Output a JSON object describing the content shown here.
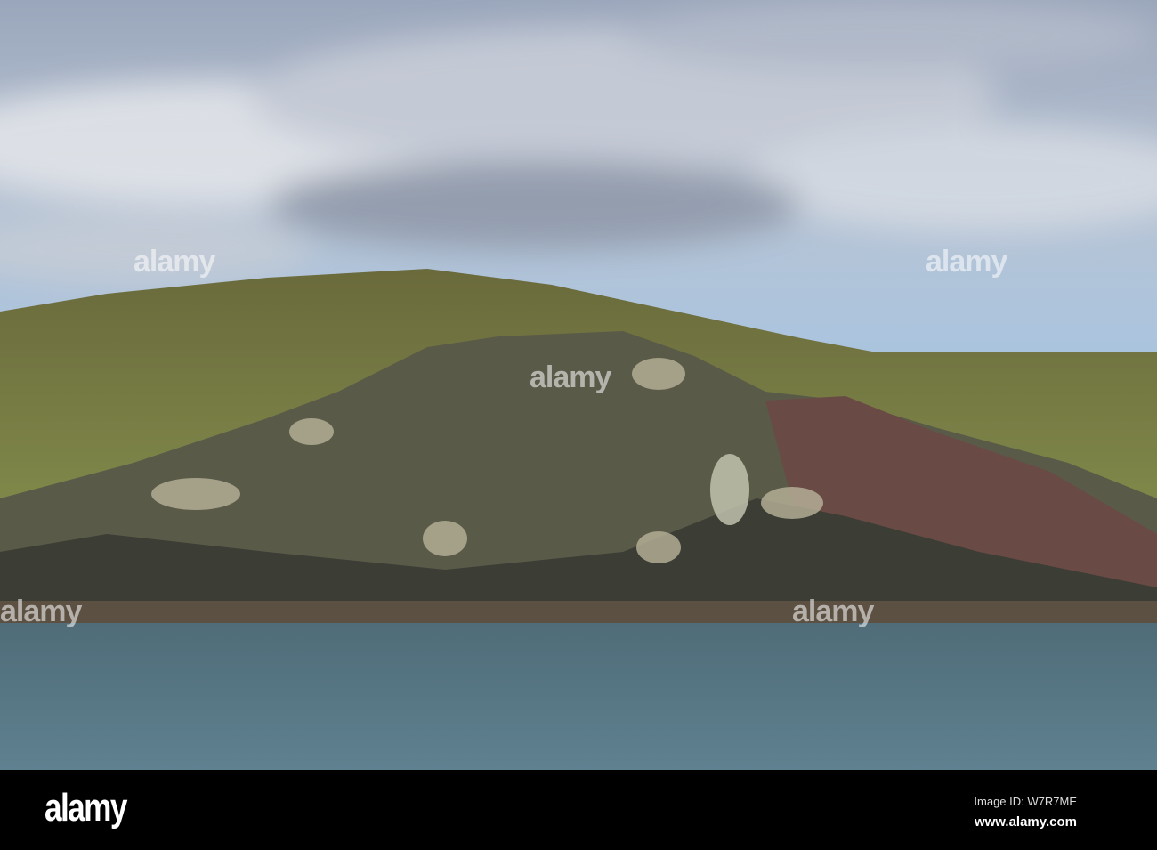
{
  "photo": {
    "subject": "Rocky coastal headland with grassy hill above the sea under a cloudy sky",
    "colors": {
      "sky": "#8fb0d4",
      "cloud": "#d8dde6",
      "grass": "#7f8a45",
      "rock": "#4a4c40",
      "sea": "#5d7d8a"
    }
  },
  "watermark": {
    "text": "alamy"
  },
  "footer": {
    "logo": "alamy",
    "image_id": "Image ID: W7R7ME",
    "url": "www.alamy.com"
  }
}
